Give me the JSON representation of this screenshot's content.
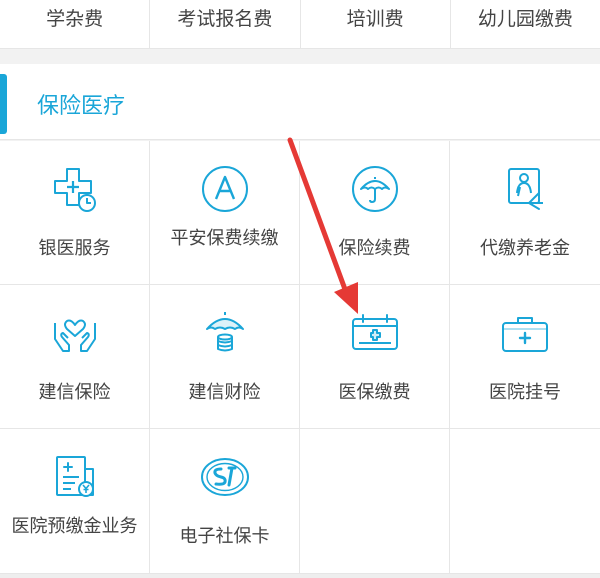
{
  "top_row": {
    "items": [
      {
        "label": "学杂费"
      },
      {
        "label": "考试报名费"
      },
      {
        "label": "培训费"
      },
      {
        "label": "幼儿园缴费"
      }
    ]
  },
  "section": {
    "title": "保险医疗"
  },
  "grid": {
    "items": [
      {
        "label": "银医服务",
        "icon": "hospital-plus-clock-icon"
      },
      {
        "label": "平安保费续缴",
        "icon": "letter-a-circle-icon"
      },
      {
        "label": "保险续费",
        "icon": "umbrella-circle-icon"
      },
      {
        "label": "代缴养老金",
        "icon": "elderly-document-icon"
      },
      {
        "label": "建信保险",
        "icon": "heart-hands-icon"
      },
      {
        "label": "建信财险",
        "icon": "umbrella-coins-icon"
      },
      {
        "label": "医保缴费",
        "icon": "medical-calendar-icon"
      },
      {
        "label": "医院挂号",
        "icon": "medical-kit-icon"
      },
      {
        "label": "医院预缴金业务",
        "icon": "hospital-prepay-icon"
      },
      {
        "label": "电子社保卡",
        "icon": "social-security-logo-icon"
      }
    ]
  },
  "colors": {
    "accent": "#1aa6d8",
    "arrow": "#e53935"
  }
}
